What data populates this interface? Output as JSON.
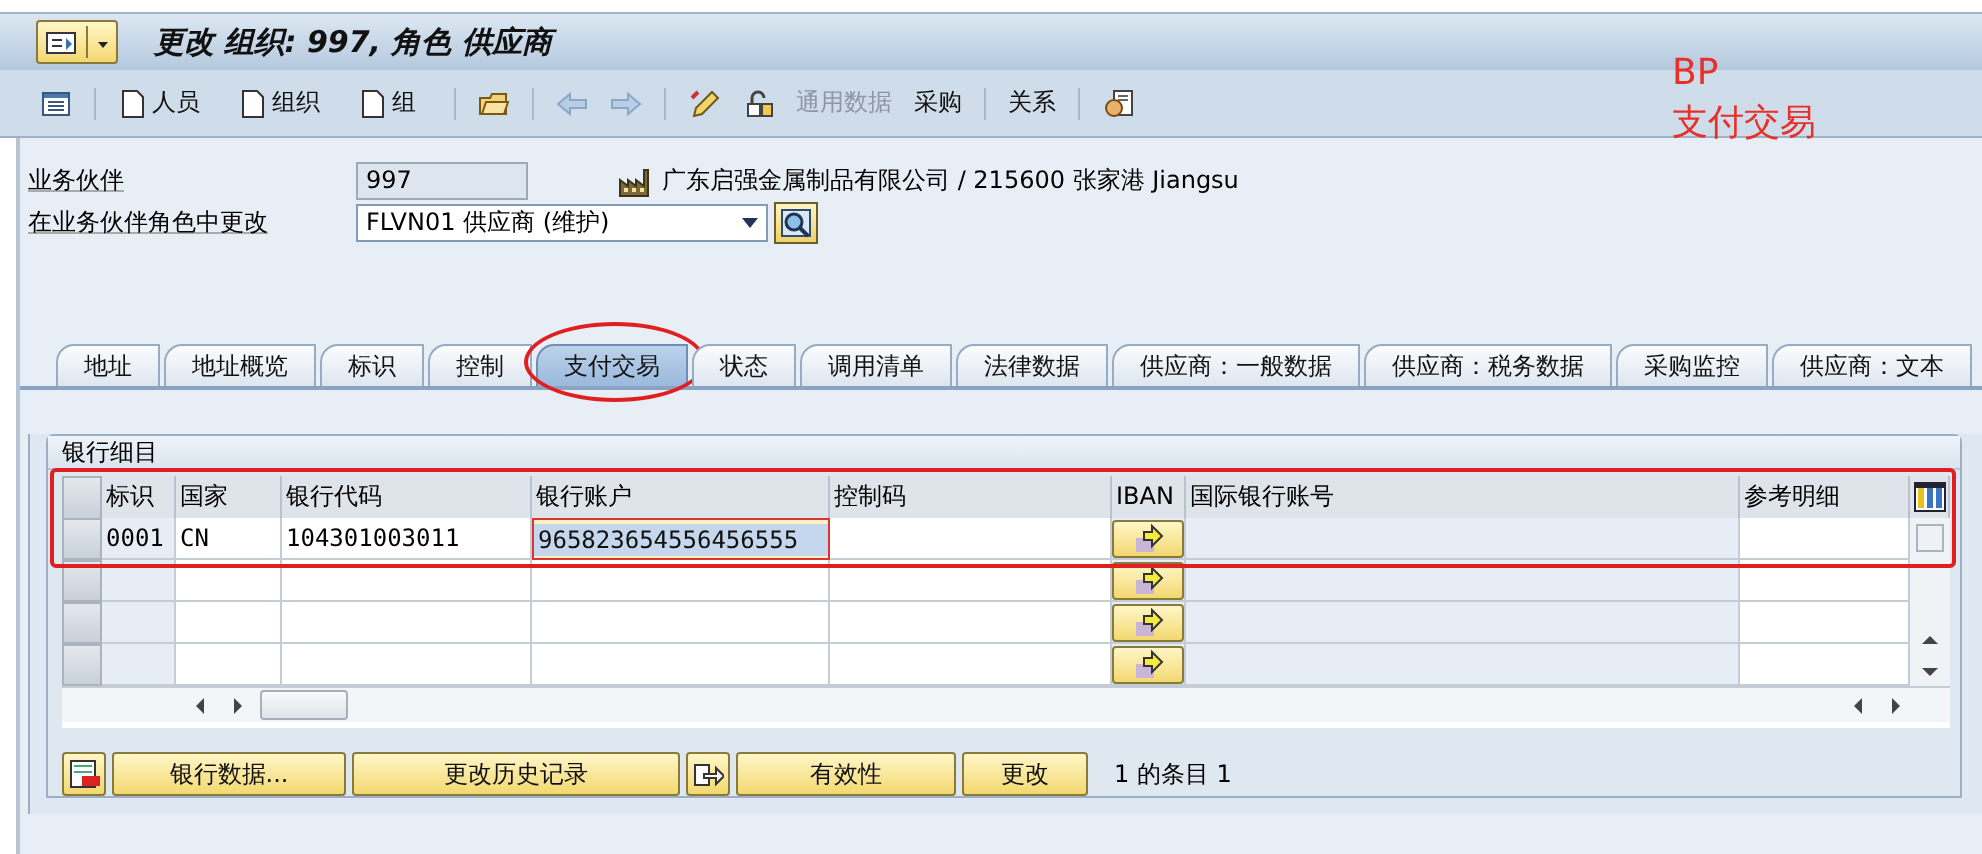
{
  "title_bar": {
    "title": "更改 组织: 997, 角色 供应商"
  },
  "toolbar": [
    {
      "kind": "icon"
    },
    {
      "kind": "separator"
    },
    {
      "kind": "new",
      "label": "人员"
    },
    {
      "kind": "new",
      "label": "组织"
    },
    {
      "kind": "new",
      "label": "组"
    },
    {
      "kind": "separator"
    },
    {
      "kind": "icon"
    },
    {
      "kind": "separator"
    },
    {
      "kind": "icon"
    },
    {
      "kind": "icon"
    },
    {
      "kind": "separator"
    },
    {
      "kind": "icon"
    },
    {
      "kind": "icon"
    },
    {
      "kind": "text",
      "label": "通用数据",
      "disabled": true
    },
    {
      "kind": "text",
      "label": "采购",
      "disabled": false
    },
    {
      "kind": "separator"
    },
    {
      "kind": "text",
      "label": "关系",
      "disabled": false
    },
    {
      "kind": "separator"
    },
    {
      "kind": "icon"
    }
  ],
  "header": {
    "partner": {
      "label": "业务伙伴",
      "value": "997"
    },
    "partner_text": "广东启强金属制品有限公司 / 215600 张家港 Jiangsu",
    "role": {
      "label": "在业务伙伴角色中更改",
      "value": "FLVN01 供应商 (维护)"
    }
  },
  "tabs": [
    {
      "label": "地址",
      "selected": false,
      "circled": false
    },
    {
      "label": "地址概览",
      "selected": false,
      "circled": false
    },
    {
      "label": "标识",
      "selected": false,
      "circled": false
    },
    {
      "label": "控制",
      "selected": false,
      "circled": false
    },
    {
      "label": "支付交易",
      "selected": true,
      "circled": true
    },
    {
      "label": "状态",
      "selected": false,
      "circled": false
    },
    {
      "label": "调用清单",
      "selected": false,
      "circled": false
    },
    {
      "label": "法律数据",
      "selected": false,
      "circled": false
    },
    {
      "label": "供应商：一般数据",
      "selected": false,
      "circled": false
    },
    {
      "label": "供应商：税务数据",
      "selected": false,
      "circled": false
    },
    {
      "label": "采购监控",
      "selected": false,
      "circled": false
    },
    {
      "label": "供应商：文本",
      "selected": false,
      "circled": false
    }
  ],
  "bank_details": {
    "title": "银行细目",
    "outlined": true,
    "columns": [
      {
        "label": "标识",
        "kind": "key"
      },
      {
        "label": "国家",
        "kind": "text"
      },
      {
        "label": "银行代码",
        "kind": "text"
      },
      {
        "label": "银行账户",
        "kind": "text"
      },
      {
        "label": "控制码",
        "kind": "text"
      },
      {
        "label": "IBAN",
        "kind": "button"
      },
      {
        "label": "国际银行账号",
        "kind": "key"
      },
      {
        "label": "参考明细",
        "kind": "text"
      }
    ],
    "rows": [
      {
        "cells": [
          {
            "text": "0001",
            "focused": false
          },
          {
            "text": "CN",
            "focused": false
          },
          {
            "text": "104301003011",
            "focused": false
          },
          {
            "text": "965823654556456555",
            "focused": true
          },
          {
            "focused": false
          },
          {
            "focused": false
          },
          {
            "focused": false
          },
          {
            "focused": false
          }
        ]
      }
    ],
    "buttons": [
      {
        "kind": "icon"
      },
      {
        "kind": "text",
        "label": "银行数据..."
      },
      {
        "kind": "text",
        "label": "更改历史记录"
      },
      {
        "kind": "icon"
      },
      {
        "kind": "text",
        "label": "有效性"
      },
      {
        "kind": "text",
        "label": "更改"
      }
    ],
    "entry_count": "1 的条目 1"
  },
  "annotation": {
    "lines": [
      "BP",
      "支付交易"
    ]
  }
}
